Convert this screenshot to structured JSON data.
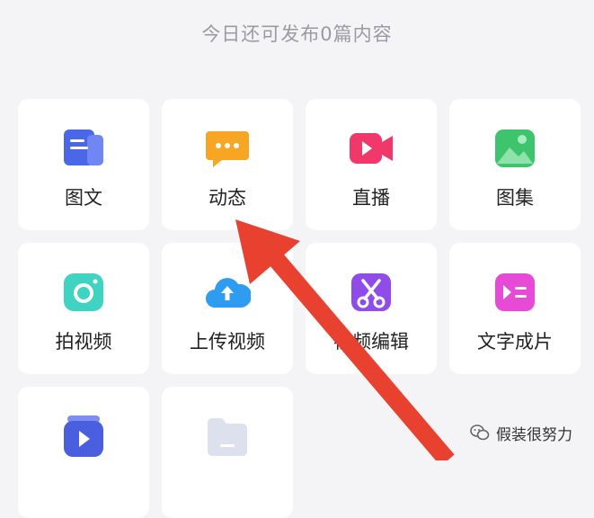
{
  "header": {
    "text": "今日还可发布0篇内容"
  },
  "grid": {
    "items": [
      {
        "label": "图文",
        "icon": "article-icon"
      },
      {
        "label": "动态",
        "icon": "chat-bubble-icon"
      },
      {
        "label": "直播",
        "icon": "video-camera-icon"
      },
      {
        "label": "图集",
        "icon": "gallery-icon"
      },
      {
        "label": "拍视频",
        "icon": "camera-icon"
      },
      {
        "label": "上传视频",
        "icon": "cloud-upload-icon"
      },
      {
        "label": "视频编辑",
        "icon": "scissors-icon"
      },
      {
        "label": "文字成片",
        "icon": "text-to-video-icon"
      },
      {
        "label": "",
        "icon": "play-icon"
      },
      {
        "label": "",
        "icon": "folder-icon"
      }
    ]
  },
  "watermark": {
    "text": "假装很努力"
  },
  "colors": {
    "background": "#f4f4f6",
    "card": "#ffffff",
    "arrow": "#e8412f"
  }
}
